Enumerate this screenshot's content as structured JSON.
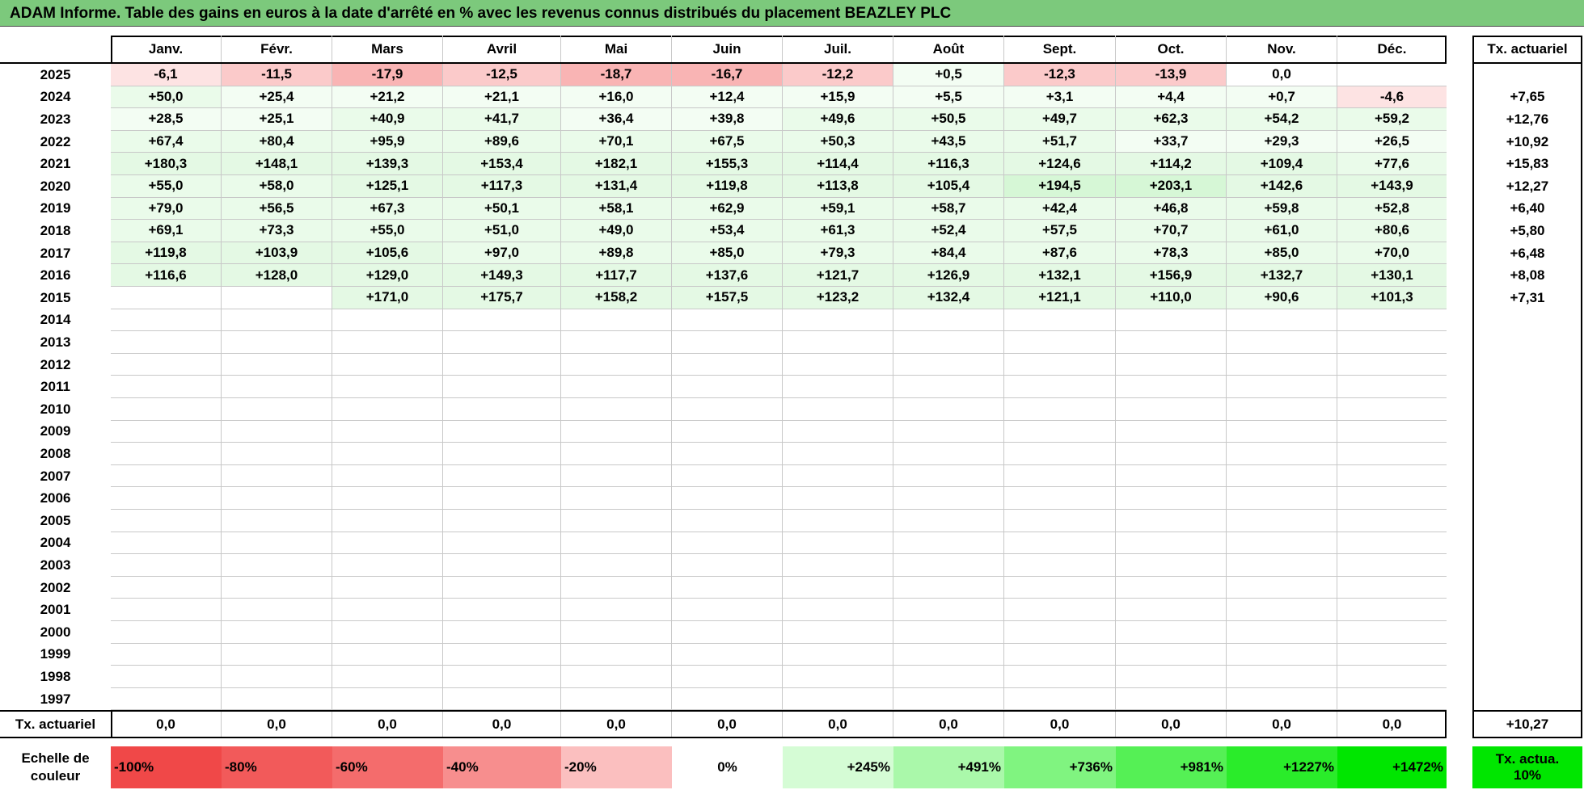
{
  "title": "ADAM Informe. Table des gains en euros à la date d'arrêté en % avec les revenus connus distribués du placement BEAZLEY PLC",
  "months": [
    "Janv.",
    "Févr.",
    "Mars",
    "Avril",
    "Mai",
    "Juin",
    "Juil.",
    "Août",
    "Sept.",
    "Oct.",
    "Nov.",
    "Déc."
  ],
  "tx_header": "Tx. actuariel",
  "rows": [
    {
      "year": "2025",
      "values": [
        "-6,1",
        "-11,5",
        "-17,9",
        "-12,5",
        "-18,7",
        "-16,7",
        "-12,2",
        "+0,5",
        "-12,3",
        "-13,9",
        "0,0",
        ""
      ],
      "tx": ""
    },
    {
      "year": "2024",
      "values": [
        "+50,0",
        "+25,4",
        "+21,2",
        "+21,1",
        "+16,0",
        "+12,4",
        "+15,9",
        "+5,5",
        "+3,1",
        "+4,4",
        "+0,7",
        "-4,6"
      ],
      "tx": "+7,65"
    },
    {
      "year": "2023",
      "values": [
        "+28,5",
        "+25,1",
        "+40,9",
        "+41,7",
        "+36,4",
        "+39,8",
        "+49,6",
        "+50,5",
        "+49,7",
        "+62,3",
        "+54,2",
        "+59,2"
      ],
      "tx": "+12,76"
    },
    {
      "year": "2022",
      "values": [
        "+67,4",
        "+80,4",
        "+95,9",
        "+89,6",
        "+70,1",
        "+67,5",
        "+50,3",
        "+43,5",
        "+51,7",
        "+33,7",
        "+29,3",
        "+26,5"
      ],
      "tx": "+10,92"
    },
    {
      "year": "2021",
      "values": [
        "+180,3",
        "+148,1",
        "+139,3",
        "+153,4",
        "+182,1",
        "+155,3",
        "+114,4",
        "+116,3",
        "+124,6",
        "+114,2",
        "+109,4",
        "+77,6"
      ],
      "tx": "+15,83"
    },
    {
      "year": "2020",
      "values": [
        "+55,0",
        "+58,0",
        "+125,1",
        "+117,3",
        "+131,4",
        "+119,8",
        "+113,8",
        "+105,4",
        "+194,5",
        "+203,1",
        "+142,6",
        "+143,9"
      ],
      "tx": "+12,27"
    },
    {
      "year": "2019",
      "values": [
        "+79,0",
        "+56,5",
        "+67,3",
        "+50,1",
        "+58,1",
        "+62,9",
        "+59,1",
        "+58,7",
        "+42,4",
        "+46,8",
        "+59,8",
        "+52,8"
      ],
      "tx": "+6,40"
    },
    {
      "year": "2018",
      "values": [
        "+69,1",
        "+73,3",
        "+55,0",
        "+51,0",
        "+49,0",
        "+53,4",
        "+61,3",
        "+52,4",
        "+57,5",
        "+70,7",
        "+61,0",
        "+80,6"
      ],
      "tx": "+5,80"
    },
    {
      "year": "2017",
      "values": [
        "+119,8",
        "+103,9",
        "+105,6",
        "+97,0",
        "+89,8",
        "+85,0",
        "+79,3",
        "+84,4",
        "+87,6",
        "+78,3",
        "+85,0",
        "+70,0"
      ],
      "tx": "+6,48"
    },
    {
      "year": "2016",
      "values": [
        "+116,6",
        "+128,0",
        "+129,0",
        "+149,3",
        "+117,7",
        "+137,6",
        "+121,7",
        "+126,9",
        "+132,1",
        "+156,9",
        "+132,7",
        "+130,1"
      ],
      "tx": "+8,08"
    },
    {
      "year": "2015",
      "values": [
        "",
        "",
        "+171,0",
        "+175,7",
        "+158,2",
        "+157,5",
        "+123,2",
        "+132,4",
        "+121,1",
        "+110,0",
        "+90,6",
        "+101,3"
      ],
      "tx": "+7,31"
    },
    {
      "year": "2014",
      "values": [
        "",
        "",
        "",
        "",
        "",
        "",
        "",
        "",
        "",
        "",
        "",
        ""
      ],
      "tx": ""
    },
    {
      "year": "2013",
      "values": [
        "",
        "",
        "",
        "",
        "",
        "",
        "",
        "",
        "",
        "",
        "",
        ""
      ],
      "tx": ""
    },
    {
      "year": "2012",
      "values": [
        "",
        "",
        "",
        "",
        "",
        "",
        "",
        "",
        "",
        "",
        "",
        ""
      ],
      "tx": ""
    },
    {
      "year": "2011",
      "values": [
        "",
        "",
        "",
        "",
        "",
        "",
        "",
        "",
        "",
        "",
        "",
        ""
      ],
      "tx": ""
    },
    {
      "year": "2010",
      "values": [
        "",
        "",
        "",
        "",
        "",
        "",
        "",
        "",
        "",
        "",
        "",
        ""
      ],
      "tx": ""
    },
    {
      "year": "2009",
      "values": [
        "",
        "",
        "",
        "",
        "",
        "",
        "",
        "",
        "",
        "",
        "",
        ""
      ],
      "tx": ""
    },
    {
      "year": "2008",
      "values": [
        "",
        "",
        "",
        "",
        "",
        "",
        "",
        "",
        "",
        "",
        "",
        ""
      ],
      "tx": ""
    },
    {
      "year": "2007",
      "values": [
        "",
        "",
        "",
        "",
        "",
        "",
        "",
        "",
        "",
        "",
        "",
        ""
      ],
      "tx": ""
    },
    {
      "year": "2006",
      "values": [
        "",
        "",
        "",
        "",
        "",
        "",
        "",
        "",
        "",
        "",
        "",
        ""
      ],
      "tx": ""
    },
    {
      "year": "2005",
      "values": [
        "",
        "",
        "",
        "",
        "",
        "",
        "",
        "",
        "",
        "",
        "",
        ""
      ],
      "tx": ""
    },
    {
      "year": "2004",
      "values": [
        "",
        "",
        "",
        "",
        "",
        "",
        "",
        "",
        "",
        "",
        "",
        ""
      ],
      "tx": ""
    },
    {
      "year": "2003",
      "values": [
        "",
        "",
        "",
        "",
        "",
        "",
        "",
        "",
        "",
        "",
        "",
        ""
      ],
      "tx": ""
    },
    {
      "year": "2002",
      "values": [
        "",
        "",
        "",
        "",
        "",
        "",
        "",
        "",
        "",
        "",
        "",
        ""
      ],
      "tx": ""
    },
    {
      "year": "2001",
      "values": [
        "",
        "",
        "",
        "",
        "",
        "",
        "",
        "",
        "",
        "",
        "",
        ""
      ],
      "tx": ""
    },
    {
      "year": "2000",
      "values": [
        "",
        "",
        "",
        "",
        "",
        "",
        "",
        "",
        "",
        "",
        "",
        ""
      ],
      "tx": ""
    },
    {
      "year": "1999",
      "values": [
        "",
        "",
        "",
        "",
        "",
        "",
        "",
        "",
        "",
        "",
        "",
        ""
      ],
      "tx": ""
    },
    {
      "year": "1998",
      "values": [
        "",
        "",
        "",
        "",
        "",
        "",
        "",
        "",
        "",
        "",
        "",
        ""
      ],
      "tx": ""
    },
    {
      "year": "1997",
      "values": [
        "",
        "",
        "",
        "",
        "",
        "",
        "",
        "",
        "",
        "",
        "",
        ""
      ],
      "tx": ""
    }
  ],
  "footer": {
    "label": "Tx. actuariel",
    "values": [
      "0,0",
      "0,0",
      "0,0",
      "0,0",
      "0,0",
      "0,0",
      "0,0",
      "0,0",
      "0,0",
      "0,0",
      "0,0",
      "0,0"
    ],
    "tx": "+10,27"
  },
  "legend": {
    "label": "Echelle de couleur",
    "items": [
      {
        "text": "-100%",
        "color": "#f04848"
      },
      {
        "text": "-80%",
        "color": "#f25a5a"
      },
      {
        "text": "-60%",
        "color": "#f46c6c"
      },
      {
        "text": "-40%",
        "color": "#f78e8e"
      },
      {
        "text": "-20%",
        "color": "#fbbfbf"
      },
      {
        "text": "0%",
        "color": "#ffffff"
      },
      {
        "text": "+245%",
        "color": "#d5fcd5"
      },
      {
        "text": "+491%",
        "color": "#aaf8aa"
      },
      {
        "text": "+736%",
        "color": "#80f480"
      },
      {
        "text": "+981%",
        "color": "#55f055"
      },
      {
        "text": "+1227%",
        "color": "#2aec2a"
      },
      {
        "text": "+1472%",
        "color": "#00e600"
      }
    ],
    "tx_label": "Tx. actua. 10%",
    "tx_color": "#00e600"
  },
  "colors": {
    "title_bg": "#7cc97c",
    "negative_strong": "#f8aaaa",
    "negative_light": "#fde0e0",
    "positive_light": "#eefcee",
    "positive_mid": "#ddf8dd"
  }
}
